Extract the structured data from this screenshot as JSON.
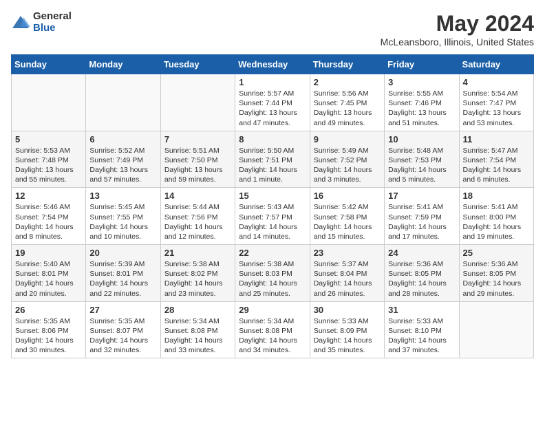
{
  "header": {
    "logo_general": "General",
    "logo_blue": "Blue",
    "title": "May 2024",
    "subtitle": "McLeansboro, Illinois, United States"
  },
  "weekdays": [
    "Sunday",
    "Monday",
    "Tuesday",
    "Wednesday",
    "Thursday",
    "Friday",
    "Saturday"
  ],
  "weeks": [
    [
      {
        "day": "",
        "info": ""
      },
      {
        "day": "",
        "info": ""
      },
      {
        "day": "",
        "info": ""
      },
      {
        "day": "1",
        "info": "Sunrise: 5:57 AM\nSunset: 7:44 PM\nDaylight: 13 hours\nand 47 minutes."
      },
      {
        "day": "2",
        "info": "Sunrise: 5:56 AM\nSunset: 7:45 PM\nDaylight: 13 hours\nand 49 minutes."
      },
      {
        "day": "3",
        "info": "Sunrise: 5:55 AM\nSunset: 7:46 PM\nDaylight: 13 hours\nand 51 minutes."
      },
      {
        "day": "4",
        "info": "Sunrise: 5:54 AM\nSunset: 7:47 PM\nDaylight: 13 hours\nand 53 minutes."
      }
    ],
    [
      {
        "day": "5",
        "info": "Sunrise: 5:53 AM\nSunset: 7:48 PM\nDaylight: 13 hours\nand 55 minutes."
      },
      {
        "day": "6",
        "info": "Sunrise: 5:52 AM\nSunset: 7:49 PM\nDaylight: 13 hours\nand 57 minutes."
      },
      {
        "day": "7",
        "info": "Sunrise: 5:51 AM\nSunset: 7:50 PM\nDaylight: 13 hours\nand 59 minutes."
      },
      {
        "day": "8",
        "info": "Sunrise: 5:50 AM\nSunset: 7:51 PM\nDaylight: 14 hours\nand 1 minute."
      },
      {
        "day": "9",
        "info": "Sunrise: 5:49 AM\nSunset: 7:52 PM\nDaylight: 14 hours\nand 3 minutes."
      },
      {
        "day": "10",
        "info": "Sunrise: 5:48 AM\nSunset: 7:53 PM\nDaylight: 14 hours\nand 5 minutes."
      },
      {
        "day": "11",
        "info": "Sunrise: 5:47 AM\nSunset: 7:54 PM\nDaylight: 14 hours\nand 6 minutes."
      }
    ],
    [
      {
        "day": "12",
        "info": "Sunrise: 5:46 AM\nSunset: 7:54 PM\nDaylight: 14 hours\nand 8 minutes."
      },
      {
        "day": "13",
        "info": "Sunrise: 5:45 AM\nSunset: 7:55 PM\nDaylight: 14 hours\nand 10 minutes."
      },
      {
        "day": "14",
        "info": "Sunrise: 5:44 AM\nSunset: 7:56 PM\nDaylight: 14 hours\nand 12 minutes."
      },
      {
        "day": "15",
        "info": "Sunrise: 5:43 AM\nSunset: 7:57 PM\nDaylight: 14 hours\nand 14 minutes."
      },
      {
        "day": "16",
        "info": "Sunrise: 5:42 AM\nSunset: 7:58 PM\nDaylight: 14 hours\nand 15 minutes."
      },
      {
        "day": "17",
        "info": "Sunrise: 5:41 AM\nSunset: 7:59 PM\nDaylight: 14 hours\nand 17 minutes."
      },
      {
        "day": "18",
        "info": "Sunrise: 5:41 AM\nSunset: 8:00 PM\nDaylight: 14 hours\nand 19 minutes."
      }
    ],
    [
      {
        "day": "19",
        "info": "Sunrise: 5:40 AM\nSunset: 8:01 PM\nDaylight: 14 hours\nand 20 minutes."
      },
      {
        "day": "20",
        "info": "Sunrise: 5:39 AM\nSunset: 8:01 PM\nDaylight: 14 hours\nand 22 minutes."
      },
      {
        "day": "21",
        "info": "Sunrise: 5:38 AM\nSunset: 8:02 PM\nDaylight: 14 hours\nand 23 minutes."
      },
      {
        "day": "22",
        "info": "Sunrise: 5:38 AM\nSunset: 8:03 PM\nDaylight: 14 hours\nand 25 minutes."
      },
      {
        "day": "23",
        "info": "Sunrise: 5:37 AM\nSunset: 8:04 PM\nDaylight: 14 hours\nand 26 minutes."
      },
      {
        "day": "24",
        "info": "Sunrise: 5:36 AM\nSunset: 8:05 PM\nDaylight: 14 hours\nand 28 minutes."
      },
      {
        "day": "25",
        "info": "Sunrise: 5:36 AM\nSunset: 8:05 PM\nDaylight: 14 hours\nand 29 minutes."
      }
    ],
    [
      {
        "day": "26",
        "info": "Sunrise: 5:35 AM\nSunset: 8:06 PM\nDaylight: 14 hours\nand 30 minutes."
      },
      {
        "day": "27",
        "info": "Sunrise: 5:35 AM\nSunset: 8:07 PM\nDaylight: 14 hours\nand 32 minutes."
      },
      {
        "day": "28",
        "info": "Sunrise: 5:34 AM\nSunset: 8:08 PM\nDaylight: 14 hours\nand 33 minutes."
      },
      {
        "day": "29",
        "info": "Sunrise: 5:34 AM\nSunset: 8:08 PM\nDaylight: 14 hours\nand 34 minutes."
      },
      {
        "day": "30",
        "info": "Sunrise: 5:33 AM\nSunset: 8:09 PM\nDaylight: 14 hours\nand 35 minutes."
      },
      {
        "day": "31",
        "info": "Sunrise: 5:33 AM\nSunset: 8:10 PM\nDaylight: 14 hours\nand 37 minutes."
      },
      {
        "day": "",
        "info": ""
      }
    ]
  ]
}
